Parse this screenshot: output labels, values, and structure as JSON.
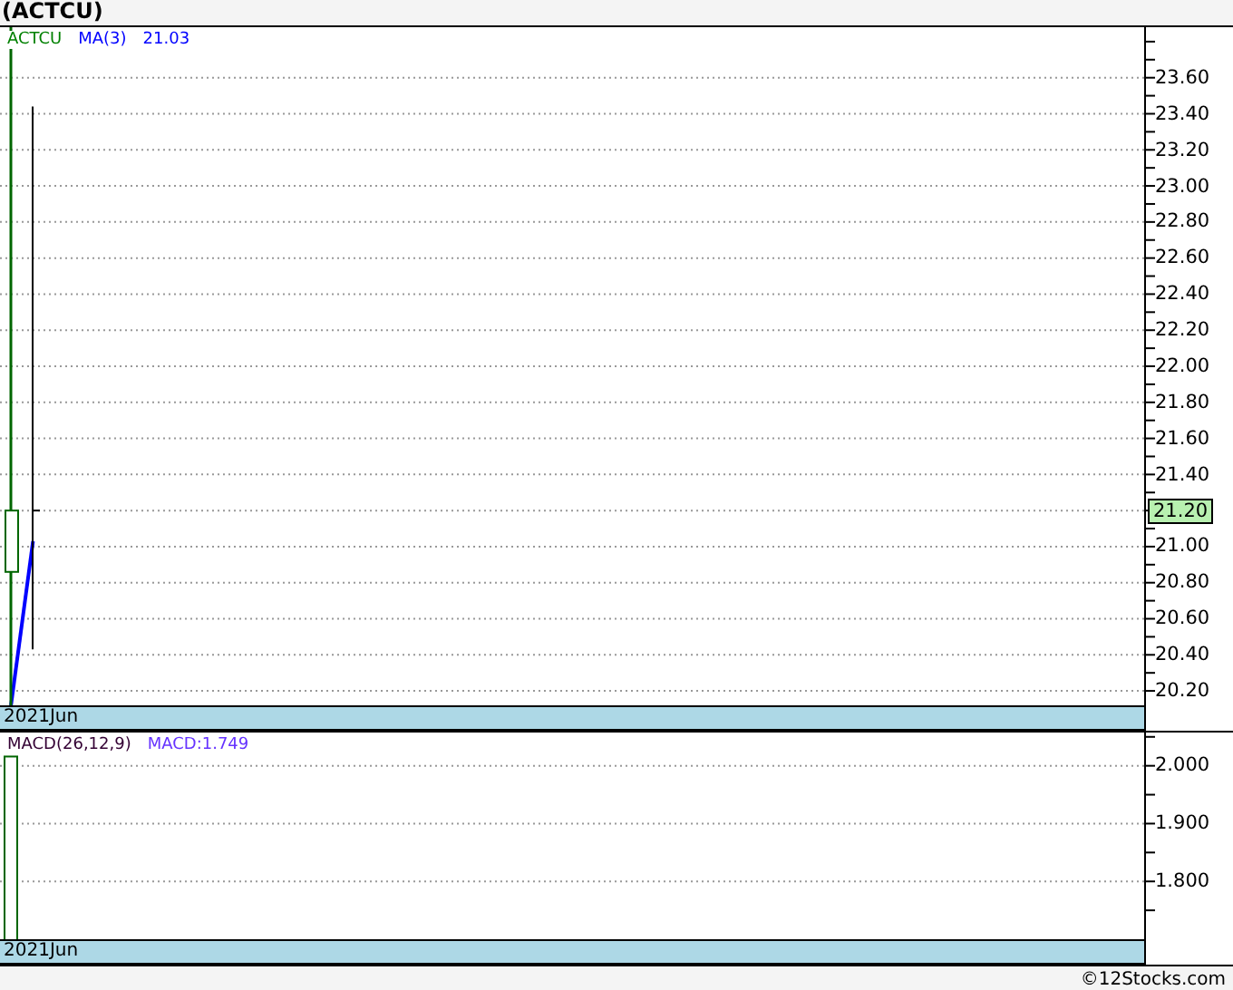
{
  "title": "(ACTCU)",
  "price_panel": {
    "symbol": {
      "text": "ACTCU",
      "color": "#008000"
    },
    "ma_value": "21.03",
    "price_tag": "21.20",
    "date_label": "2021Jun",
    "chart_data": {
      "type": "line",
      "categories": [
        null,
        null,
        null,
        null,
        null,
        null,
        null,
        null,
        null,
        null,
        null,
        null,
        null,
        null,
        null,
        null,
        null,
        null,
        null,
        null,
        null,
        null,
        null,
        null,
        null,
        null,
        null,
        null,
        null,
        null,
        null,
        null,
        null,
        null,
        null,
        null,
        null,
        null,
        null,
        null,
        null,
        null,
        null,
        null,
        null,
        null,
        null,
        null,
        null,
        null,
        null,
        null
      ],
      "grid": true,
      "series": [
        {
          "name": "MA(3)",
          "color": "#0000ff",
          "values": [
            20.12,
            21.03,
            null,
            null,
            null,
            null,
            null,
            null,
            null,
            null,
            null,
            null,
            null,
            null,
            null,
            null,
            null,
            null,
            null,
            null,
            null,
            null,
            null,
            null,
            null,
            null,
            null,
            null,
            null,
            null,
            null,
            null,
            null,
            null,
            null,
            null,
            null,
            null,
            null,
            null,
            null,
            null,
            null,
            null,
            null,
            null,
            null,
            null,
            null,
            null,
            null,
            null
          ]
        }
      ],
      "ylim": [
        20.12,
        23.88
      ],
      "yticks": [
        {
          "value": 20.2,
          "label": "20.20"
        },
        {
          "value": 20.4,
          "label": "20.40"
        },
        {
          "value": 20.6,
          "label": "20.60"
        },
        {
          "value": 20.8,
          "label": "20.80"
        },
        {
          "value": 21.0,
          "label": "21.00"
        },
        {
          "value": 21.4,
          "label": "21.40"
        },
        {
          "value": 21.6,
          "label": "21.60"
        },
        {
          "value": 21.8,
          "label": "21.80"
        },
        {
          "value": 22.0,
          "label": "22.00"
        },
        {
          "value": 22.2,
          "label": "22.20"
        },
        {
          "value": 22.4,
          "label": "22.40"
        },
        {
          "value": 22.6,
          "label": "22.60"
        },
        {
          "value": 22.8,
          "label": "22.80"
        },
        {
          "value": 23.0,
          "label": "23.00"
        },
        {
          "value": 23.2,
          "label": "23.20"
        },
        {
          "value": 23.4,
          "label": "23.40"
        },
        {
          "value": 23.6,
          "label": "23.60"
        }
      ]
    }
  },
  "macd_panel": {
    "legend": [
      {
        "text": "MACD(26,12,9)",
        "color": "#330033"
      },
      {
        "text": "MACD:1.749",
        "color": "#6633ff"
      }
    ],
    "date_label": "2021Jun",
    "chart_data": {
      "type": "bar",
      "categories": [
        null
      ],
      "grid": true,
      "values": [
        2.016
      ],
      "ylim": [
        1.7,
        2.0575
      ],
      "yticks": [
        {
          "value": 1.8,
          "label": "1.800"
        },
        {
          "value": 1.9,
          "label": "1.900"
        },
        {
          "value": 2.0,
          "label": "2.000"
        }
      ]
    }
  },
  "credit": "©12Stocks.com"
}
